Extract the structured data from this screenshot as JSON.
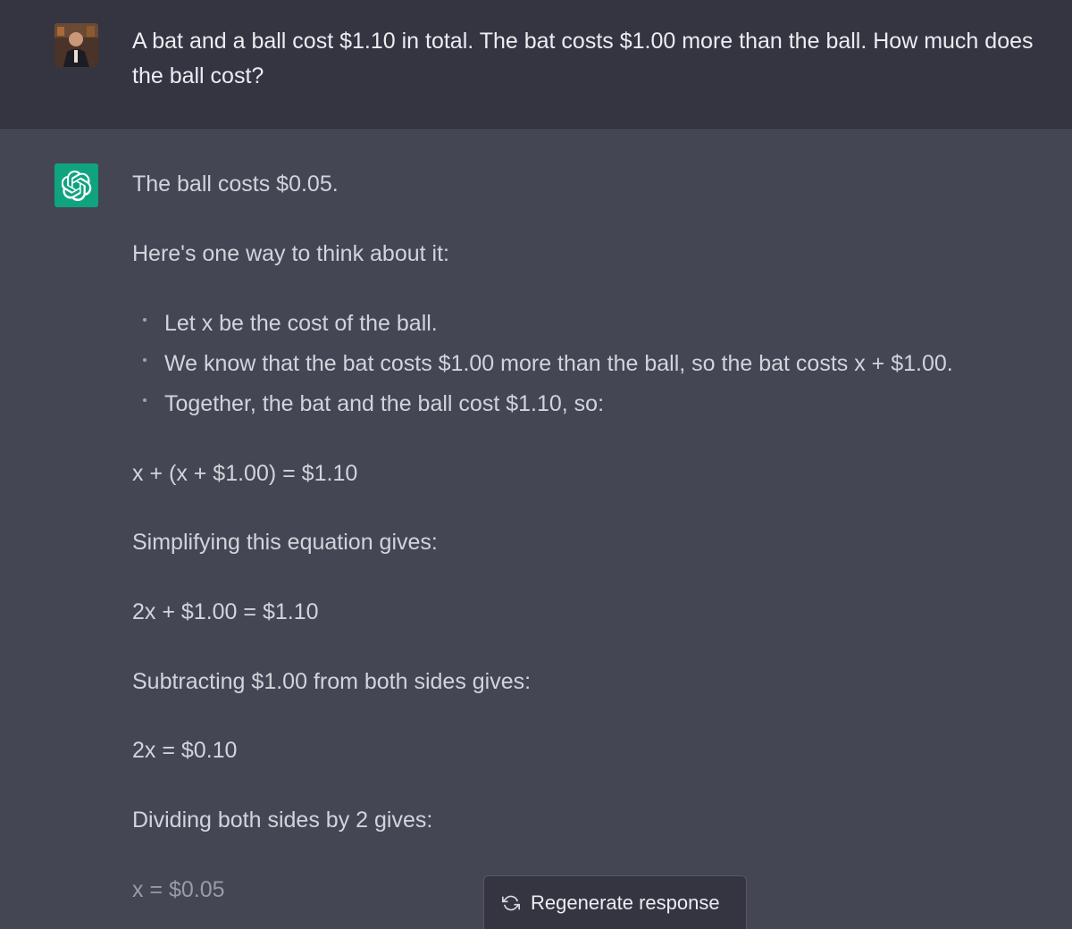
{
  "user": {
    "message": "A bat and a ball cost $1.10 in total. The bat costs $1.00 more than the ball. How much does the ball cost?"
  },
  "assistant": {
    "answer": "The ball costs $0.05.",
    "intro": "Here's one way to think about it:",
    "bullets": [
      "Let x be the cost of the ball.",
      "We know that the bat costs $1.00 more than the ball, so the bat costs x + $1.00.",
      "Together, the bat and the ball cost $1.10, so:"
    ],
    "equation1": "x + (x + $1.00) = $1.10",
    "step1": "Simplifying this equation gives:",
    "equation2": "2x + $1.00 = $1.10",
    "step2": "Subtracting $1.00 from both sides gives:",
    "equation3": "2x = $0.10",
    "step3": "Dividing both sides by 2 gives:",
    "equation4": "x = $0.05"
  },
  "controls": {
    "regenerate_label": "Regenerate response",
    "regenerate_icon": "refresh-icon"
  },
  "colors": {
    "user_bg": "#343541",
    "assistant_bg": "#444654",
    "bot_avatar": "#10a37f"
  }
}
